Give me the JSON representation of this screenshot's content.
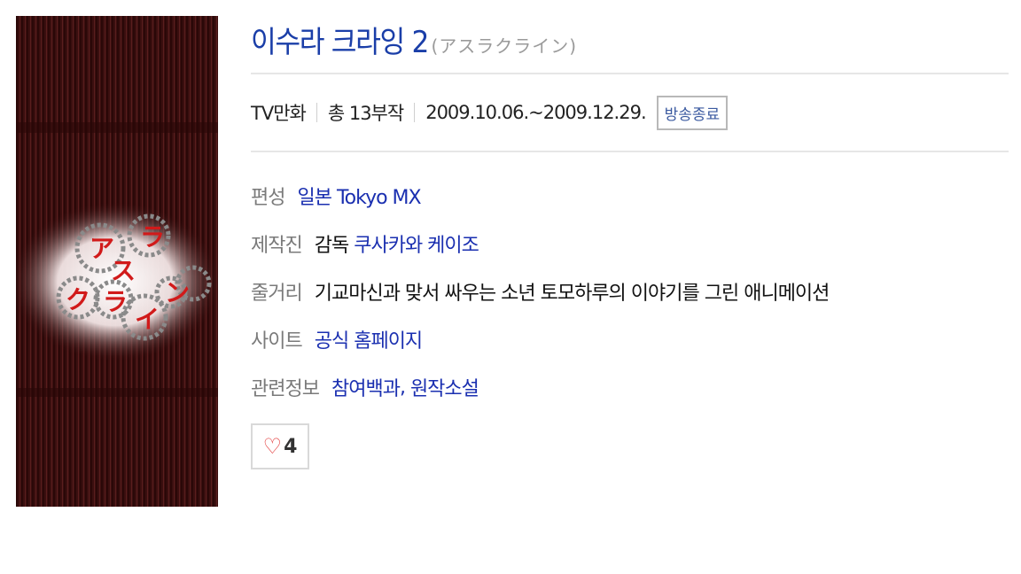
{
  "poster": {
    "kana": [
      "ア",
      "ス",
      "ラ",
      "ク",
      "ラ",
      "イ",
      "ン"
    ]
  },
  "header": {
    "title": "이수라 크라잉 2",
    "subtitle": "(アスラクライン)"
  },
  "meta": {
    "type": "TV만화",
    "episodes": "총 13부작",
    "period": "2009.10.06.~2009.12.29.",
    "status": "방송종료"
  },
  "info": {
    "network_label": "편성",
    "network": "일본 Tokyo MX",
    "staff_label": "제작진",
    "director_role": "감독",
    "director": "쿠사카와 케이조",
    "synopsis_label": "줄거리",
    "synopsis": "기교마신과 맞서 싸우는 소년 토모하루의 이야기를 그린 애니메이션",
    "site_label": "사이트",
    "site": "공식 홈페이지",
    "related_label": "관련정보",
    "related_1": "참여백과",
    "related_sep": ",",
    "related_2": "원작소설"
  },
  "like": {
    "icon": "heart-outline-icon",
    "count": "4"
  },
  "colors": {
    "link": "#1a2fb0",
    "title": "#1a3ea8",
    "heart": "#e33a3a",
    "poster_bg": "#3c1010"
  }
}
